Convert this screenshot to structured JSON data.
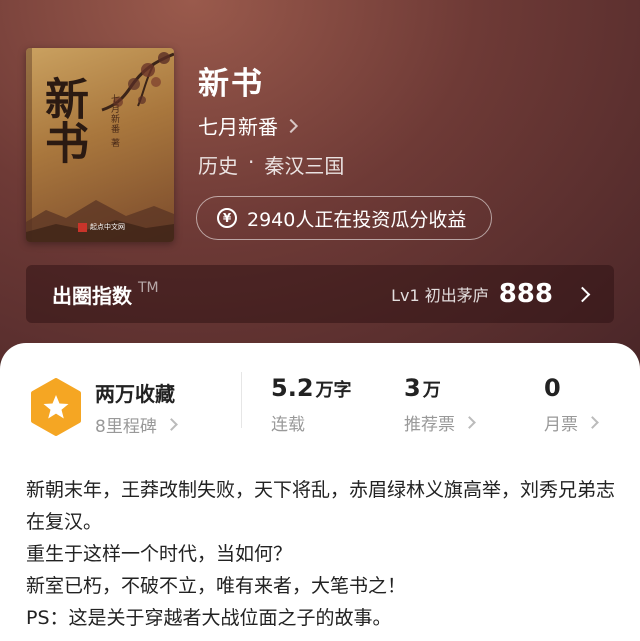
{
  "book": {
    "title": "新书",
    "author": "七月新番",
    "genre_main": "历史",
    "genre_sep": "·",
    "genre_sub": "秦汉三国",
    "invest_icon": "yen-circle-icon",
    "invest_text": "2940人正在投资瓜分收益"
  },
  "cover": {
    "title": "新书",
    "author": "七月新番 著",
    "publisher": "起点中文网"
  },
  "circle_index": {
    "label": "出圈指数",
    "tm": "TM",
    "level": "Lv1 初出茅庐",
    "score": "888"
  },
  "stats": {
    "favorites_title": "两万收藏",
    "milestone": "8里程碑",
    "words_value": "5.2",
    "words_unit": "万字",
    "words_label": "连载",
    "rec_value": "3",
    "rec_unit": "万",
    "rec_label": "推荐票",
    "month_value": "0",
    "month_label": "月票"
  },
  "description": [
    "新朝末年，王莽改制失败，天下将乱，赤眉绿林义旗高举，刘秀兄弟志在复汉。",
    "重生于这样一个时代，当如何？",
    "新室已朽，不破不立，唯有来者，大笔书之！",
    "PS：这是关于穿越者大战位面之子的故事。"
  ],
  "colors": {
    "hero_bg": "#6e3a36",
    "badge": "#f5a623",
    "panel_bg": "#ffffff"
  }
}
